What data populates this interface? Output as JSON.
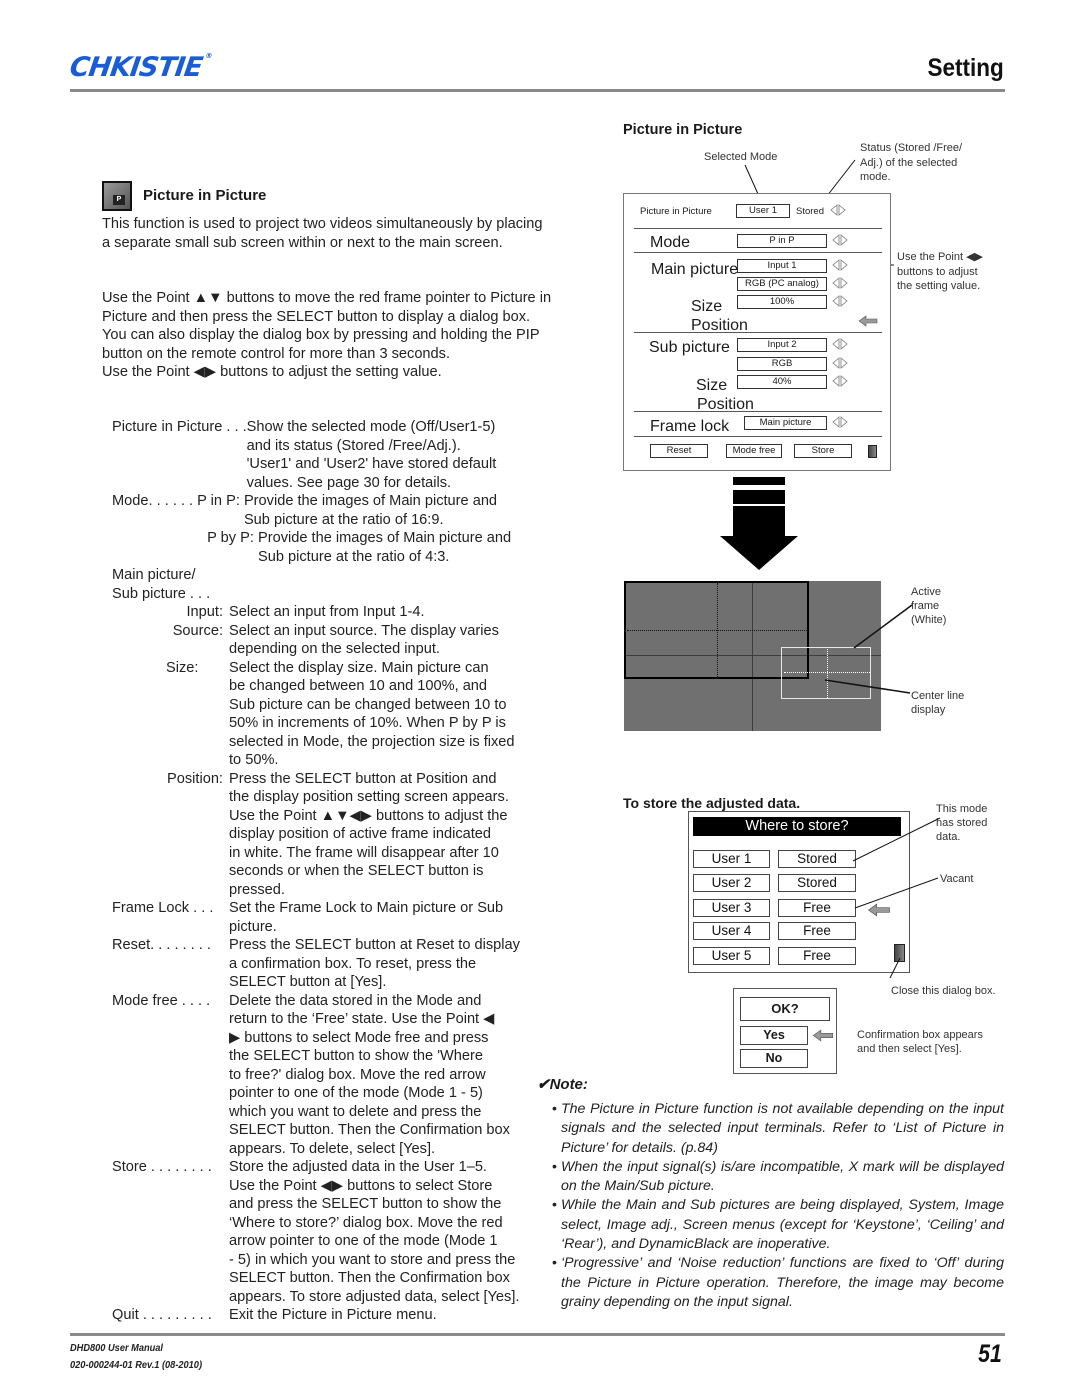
{
  "header": {
    "brand": "CHKISTIE",
    "brand_mark": "®",
    "brand_color": "#1a5bd6",
    "section": "Setting"
  },
  "left": {
    "section_icon": "pip-menu-icon",
    "section_icon_glyph": "P",
    "title": "Picture in Picture",
    "intro": "This function is used to project two videos simultaneously by placing a separate small sub screen within or next to the main screen.",
    "instructions": "Use the Point ▲▼ buttons to move the red frame pointer to Picture in Picture and then press the SELECT button to display a dialog box. You can also display the dialog box by pressing and holding the PIP button on the remote control for more than 3 seconds.\nUse the Point ◀▶ buttons to adjust the setting value.",
    "items": [
      {
        "term": "Picture in Picture . . .",
        "desc": "Show the selected mode (Off/User1-5)\nand its status (Stored /Free/Adj.).\n'User1' and 'User2' have stored default\nvalues. See page 30 for details."
      },
      {
        "term": "Mode. . . . . . P in P: ",
        "desc": "Provide the images of Main picture and\nSub picture at the ratio of 16:9."
      },
      {
        "term": "P by P: ",
        "desc": "Provide the images of Main picture and\nSub picture at the ratio of 4:3."
      },
      {
        "term": "Main picture/\nSub picture . . .",
        "desc": ""
      },
      {
        "term": "Input:",
        "desc": "Select an input from Input 1-4."
      },
      {
        "term": "Source:",
        "desc": "Select an input source. The display varies\ndepending on the selected input."
      },
      {
        "term": "Size:",
        "desc": "Select the display size. Main picture can\nbe changed between 10 and 100%, and\nSub picture can be changed between 10 to\n50% in increments of 10%. When P by P is\nselected in Mode, the projection size is fixed\nto 50%."
      },
      {
        "term": "Position:",
        "desc": "Press the SELECT button at Position and\nthe display position setting screen appears.\nUse the Point ▲▼◀▶ buttons to adjust the\ndisplay position of active frame indicated\nin white. The frame will disappear after 10\nseconds or when the SELECT button is\npressed."
      },
      {
        "term": "Frame Lock . . . ",
        "desc": "Set the Frame Lock to Main picture or Sub\npicture."
      },
      {
        "term": "Reset. . . . . . . . ",
        "desc": "Press the SELECT button at Reset to display\na confirmation box. To reset, press the\nSELECT button at [Yes]."
      },
      {
        "term": "Mode free . . . . ",
        "desc": "Delete the data stored in the Mode and\nreturn to the ‘Free’ state. Use the Point ◀\n▶ buttons to select Mode free and press\nthe SELECT button to show the 'Where\nto free?' dialog box. Move the red arrow\npointer to one of the mode (Mode 1 - 5)\nwhich you want to delete and press the\nSELECT button. Then the Confirmation box\nappears. To delete, select [Yes]."
      },
      {
        "term": "Store . . . . . . . . ",
        "desc": "Store the adjusted data in the User 1–5.\nUse the Point ◀▶ buttons to select Store\nand press the SELECT button to show the\n‘Where to store?’ dialog box. Move the red\narrow pointer to one of the mode (Mode 1\n- 5) in which you want to store and press the\nSELECT button. Then the Confirmation box\nappears. To store adjusted data, select [Yes]."
      },
      {
        "term": "Quit . . . . . . . . . ",
        "desc": "Exit the Picture in Picture menu."
      }
    ]
  },
  "right": {
    "title": "Picture in Picture",
    "callouts": {
      "selected_mode": "Selected Mode",
      "status": "Status (Stored /Free/\nAdj.) of the selected\nmode.",
      "point_buttons": "Use the Point ◀▶\nbuttons to adjust\nthe setting value.",
      "active_frame": "Active\nframe\n(White)",
      "center_line": "Center line\ndisplay",
      "stored": "This mode\nhas stored\ndata.",
      "vacant": "Vacant",
      "close_dialog": "Close this dialog box.",
      "confirm": "Confirmation box appears\nand then select [Yes]."
    },
    "osd": {
      "pip_label": "Picture in Picture",
      "pip_value": "User 1",
      "pip_status": "Stored",
      "mode_label": "Mode",
      "mode_value": "P in P",
      "main_label": "Main picture",
      "main_input": "Input 1",
      "main_source": "RGB (PC analog)",
      "main_size_label": "Size",
      "main_size": "100%",
      "main_position_label": "Position",
      "sub_label": "Sub picture",
      "sub_input": "Input 2",
      "sub_source": "RGB",
      "sub_size_label": "Size",
      "sub_size": "40%",
      "sub_position_label": "Position",
      "frame_lock_label": "Frame lock",
      "frame_lock_value": "Main picture",
      "buttons": [
        "Reset",
        "Mode free",
        "Store"
      ]
    },
    "store_title": "To store the adjusted data.",
    "store_dialog": {
      "heading": "Where to store?",
      "rows": [
        {
          "user": "User 1",
          "status": "Stored"
        },
        {
          "user": "User 2",
          "status": "Stored"
        },
        {
          "user": "User 3",
          "status": "Free"
        },
        {
          "user": "User 4",
          "status": "Free"
        },
        {
          "user": "User 5",
          "status": "Free"
        }
      ]
    },
    "confirm_dialog": {
      "heading": "OK?",
      "yes": "Yes",
      "no": "No"
    }
  },
  "note": {
    "heading": "✔Note:",
    "items": [
      "The Picture in Picture function is not available depending on the input signals and the selected input terminals. Refer to ‘List of Picture in Picture’ for details. (p.84)",
      "When the input signal(s) is/are incompatible, X mark will be displayed on the Main/Sub picture.",
      "While the Main and Sub pictures are being displayed, System, Image select, Image adj., Screen menus (except for ‘Keystone’, ‘Ceiling’ and ‘Rear’), and DynamicBlack are inoperative.",
      "‘Progressive’ and ‘Noise reduction’ functions are fixed to ‘Off’ during the Picture in Picture operation. Therefore, the image may become grainy depending on the input signal."
    ]
  },
  "footer": {
    "manual": "DHD800 User Manual",
    "revision": "020-000244-01 Rev.1 (08-2010)",
    "page_number": "51"
  }
}
